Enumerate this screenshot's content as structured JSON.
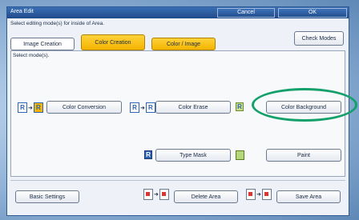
{
  "window": {
    "title": "Area Edit",
    "cancel_label": "Cancel",
    "ok_label": "OK",
    "instruction": "Select editing mode(s) for inside of Area."
  },
  "tabs": [
    {
      "label": "Image Creation"
    },
    {
      "label": "Color Creation"
    },
    {
      "label": "Color / Image"
    }
  ],
  "check_modes_label": "Check Modes",
  "select_modes_hint": "Select mode(s).",
  "buttons": {
    "color_conversion": "Color Conversion",
    "color_erase": "Color Erase",
    "color_background": "Color Background",
    "type_mask": "Type Mask",
    "paint": "Paint"
  },
  "footer": {
    "basic_settings": "Basic Settings",
    "delete_area": "Delete Area",
    "save_area": "Save Area"
  },
  "icon_letters": {
    "r": "R"
  },
  "colors": {
    "title_bar": "#1f4a8a",
    "active_tab": "#f4b400",
    "highlight_oval": "#13a06a"
  }
}
